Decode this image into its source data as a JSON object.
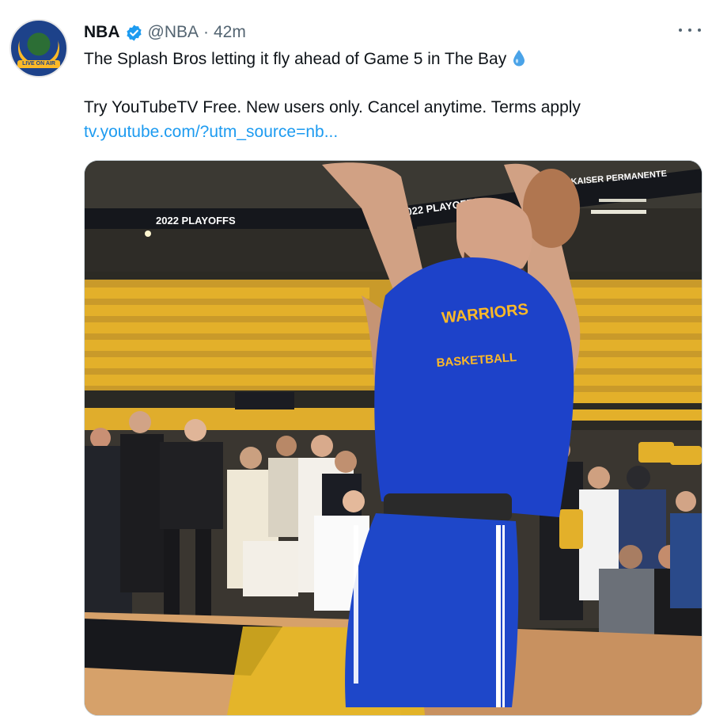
{
  "tweet": {
    "author_name": "NBA",
    "handle": "@NBA",
    "separator": "·",
    "time": "42m",
    "text_line1": "The Splash Bros letting it fly ahead of Game 5 in The Bay",
    "text_line2": "Try YouTubeTV Free. New users only. Cancel anytime. Terms apply",
    "link_text": "tv.youtube.com/?utm_source=nb..."
  },
  "avatar": {
    "ribbon_text": "LIVE ON AIR"
  },
  "media": {
    "banner_left": "2022 PLAYOFFS",
    "banner_right": "2022 PLAYOFFS",
    "banner_sponsor": "KAISER PERMANENTE",
    "jersey_text_top": "WARRIORS",
    "jersey_text_bottom": "BASKETBALL"
  },
  "colors": {
    "verified": "#1d9bf0",
    "link": "#1d9bf0",
    "jersey_blue": "#1d42c9",
    "seat_yellow": "#e3b02a"
  }
}
